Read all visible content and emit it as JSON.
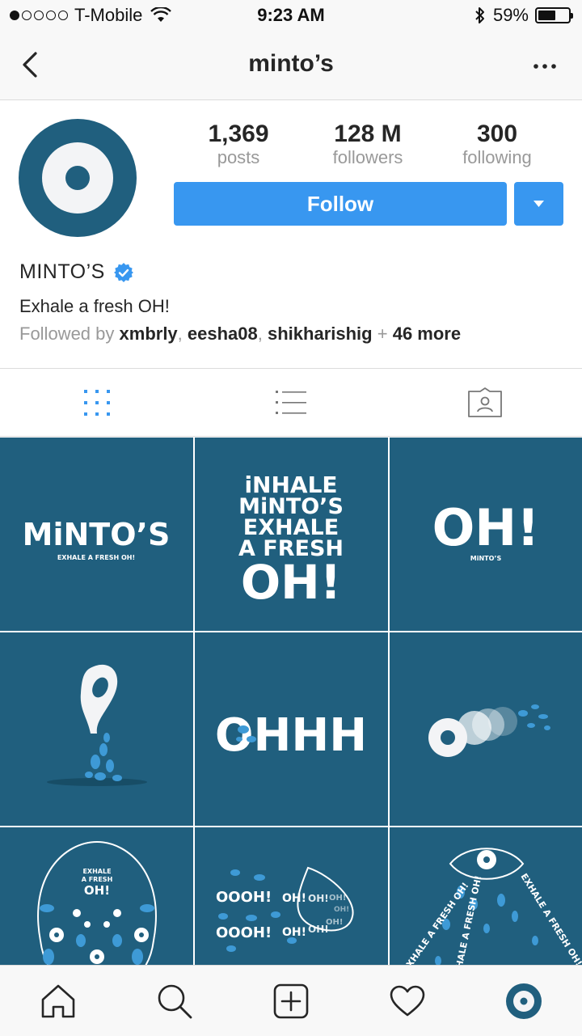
{
  "status_bar": {
    "carrier": "T-Mobile",
    "time": "9:23 AM",
    "battery_percent": "59%",
    "battery_level": 0.59,
    "signal_bars_filled": 1,
    "signal_bars_total": 5
  },
  "header": {
    "title": "minto’s"
  },
  "profile": {
    "stats": [
      {
        "value": "1,369",
        "label": "posts"
      },
      {
        "value": "128 M",
        "label": "followers"
      },
      {
        "value": "300",
        "label": "following"
      }
    ],
    "follow_label": "Follow",
    "display_name": "MINTO’S",
    "verified": true,
    "bio": "Exhale a fresh OH!",
    "followed_by": {
      "prefix": "Followed by",
      "users": [
        "xmbrly",
        "eesha08",
        "shikharishig"
      ],
      "plus": "+",
      "more": "46 more"
    }
  },
  "tabs": [
    "grid-view",
    "list-view",
    "tagged-view"
  ],
  "posts": [
    {
      "lines": [
        "MiNTO’S",
        "EXHALE A FRESH OH!"
      ]
    },
    {
      "lines": [
        "iNHALE",
        "MiNTO’S",
        "EXHALE",
        "A FRESH",
        "OH!"
      ]
    },
    {
      "lines": [
        "OH!",
        "MiNTO’S"
      ]
    },
    {
      "lines": []
    },
    {
      "lines": [
        "OHHH"
      ]
    },
    {
      "lines": []
    },
    {
      "lines": [
        "EXHALE",
        "A FRESH",
        "OH!"
      ]
    },
    {
      "lines": [
        "OOOH!",
        "OH!",
        "OH!",
        "OH!",
        "OH!",
        "OOOH!",
        "OH!",
        "OH!",
        "OH!"
      ]
    },
    {
      "lines": [
        "EXHALE A FRESH OH!",
        "EXHALE A FRESH OH!",
        "EXHALE A FRESH OH!"
      ]
    }
  ],
  "colors": {
    "brand_teal": "#205f7e",
    "follow_blue": "#3897f0",
    "accent_light_blue": "#3e9ad6"
  }
}
